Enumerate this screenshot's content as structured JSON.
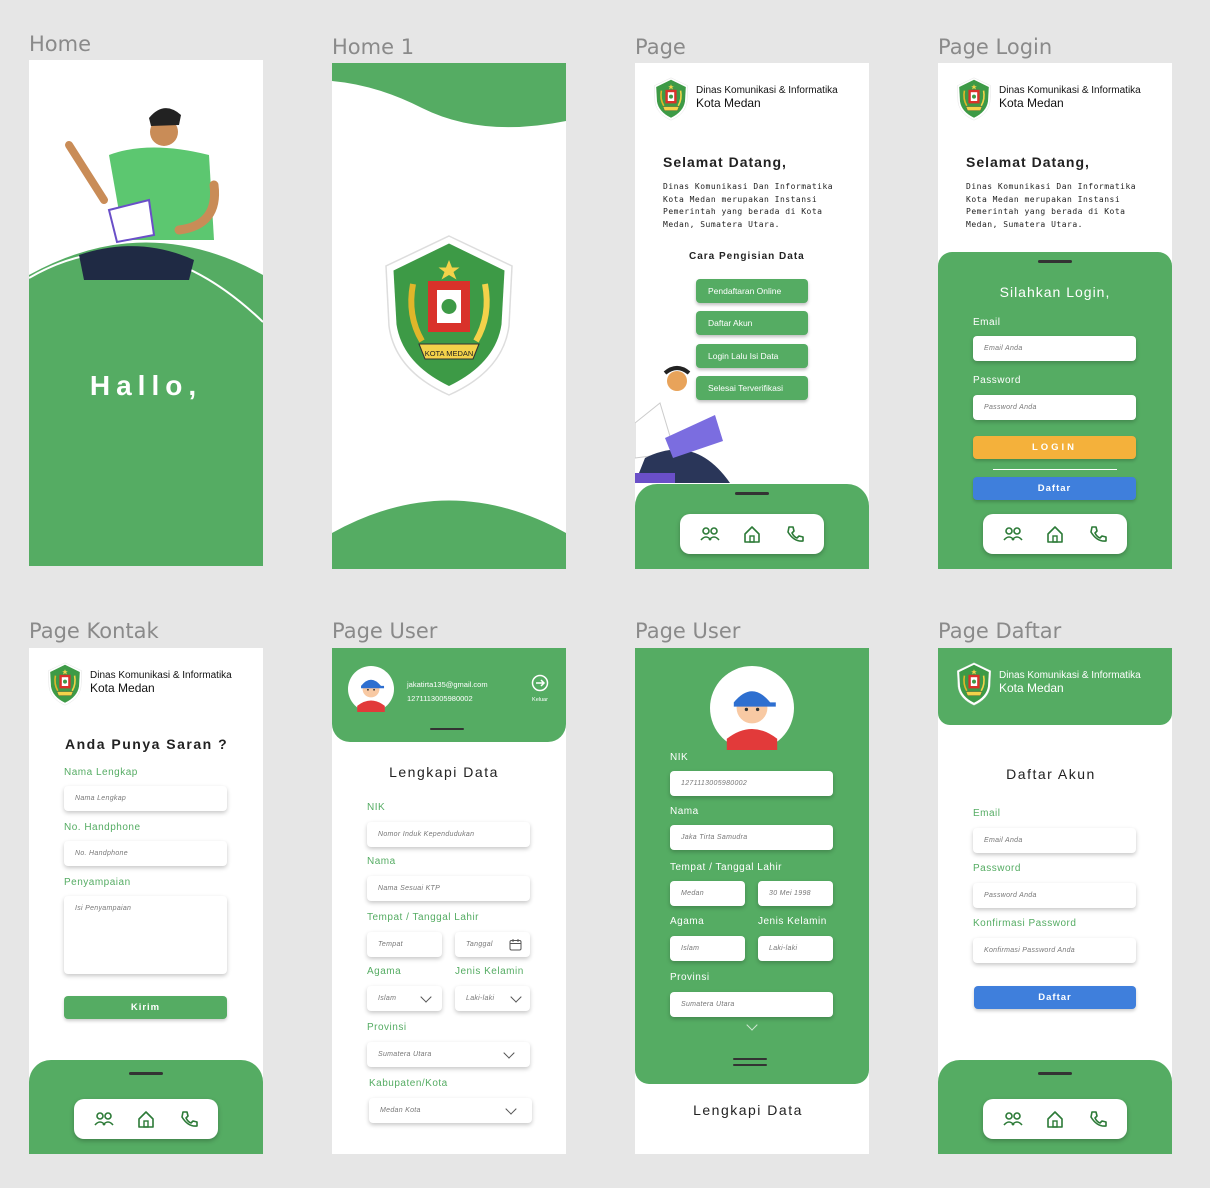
{
  "frames": {
    "home": "Home",
    "home1": "Home 1",
    "page": "Page",
    "login": "Page Login",
    "kontak": "Page Kontak",
    "user1": "Page User",
    "user2": "Page User",
    "daftar": "Page Daftar"
  },
  "colors": {
    "primary": "#55ac63",
    "login_btn": "#f4b13b",
    "daftar_btn": "#3f7fdc"
  },
  "header": {
    "line1": "Dinas Komunikasi & Informatika",
    "line2": "Kota Medan"
  },
  "home": {
    "greeting": "Hallo,"
  },
  "logo": {
    "ribbon": "KOTA MEDAN"
  },
  "welcome": {
    "title": "Selamat Datang,",
    "description": "Dinas Komunikasi Dan Informatika Kota Medan merupakan Instansi Pemerintah yang berada di Kota Medan, Sumatera Utara."
  },
  "page": {
    "section": "Cara Pengisian Data",
    "steps": [
      "Pendaftaran Online",
      "Daftar Akun",
      "Login Lalu Isi Data",
      "Selesai Terverifikasi"
    ]
  },
  "nav": {
    "icons": [
      "users-icon",
      "home-icon",
      "phone-icon"
    ]
  },
  "login": {
    "title": "Silahkan Login,",
    "email_label": "Email",
    "email_placeholder": "Email Anda",
    "password_label": "Password",
    "password_placeholder": "Password Anda",
    "login_btn": "LOGIN",
    "daftar_btn": "Daftar"
  },
  "kontak": {
    "title": "Anda Punya Saran ?",
    "nama_label": "Nama Lengkap",
    "nama_placeholder": "Nama Lengkap",
    "hp_label": "No. Handphone",
    "hp_placeholder": "No. Handphone",
    "penyampaian_label": "Penyampaian",
    "penyampaian_placeholder": "Isi Penyampaian",
    "submit": "Kirim"
  },
  "user1": {
    "email": "jakatirta135@gmail.com",
    "id": "1271113005980002",
    "logout": "Keluar",
    "title": "Lengkapi Data",
    "nik_label": "NIK",
    "nik_placeholder": "Nomor Induk Kependudukan",
    "nama_label": "Nama",
    "nama_placeholder": "Nama Sesuai KTP",
    "ttl_label": "Tempat / Tanggal Lahir",
    "tempat_placeholder": "Tempat",
    "tanggal_placeholder": "Tanggal",
    "agama_label": "Agama",
    "agama_value": "Islam",
    "jk_label": "Jenis Kelamin",
    "jk_value": "Laki-laki",
    "provinsi_label": "Provinsi",
    "provinsi_value": "Sumatera Utara",
    "kab_label": "Kabupaten/Kota",
    "kab_value": "Medan Kota"
  },
  "user2": {
    "nik_label": "NIK",
    "nik_value": "1271113005980002",
    "nama_label": "Nama",
    "nama_value": "Jaka Tirta Samudra",
    "ttl_label": "Tempat / Tanggal Lahir",
    "tempat_value": "Medan",
    "tanggal_value": "30 Mei 1998",
    "agama_label": "Agama",
    "agama_value": "Islam",
    "jk_label": "Jenis Kelamin",
    "jk_value": "Laki-laki",
    "provinsi_label": "Provinsi",
    "provinsi_value": "Sumatera Utara",
    "footer_title": "Lengkapi Data"
  },
  "daftar": {
    "title": "Daftar Akun",
    "email_label": "Email",
    "email_placeholder": "Email Anda",
    "password_label": "Password",
    "password_placeholder": "Password Anda",
    "confirm_label": "Konfirmasi Password",
    "confirm_placeholder": "Konfirmasi Password Anda",
    "submit": "Daftar"
  }
}
